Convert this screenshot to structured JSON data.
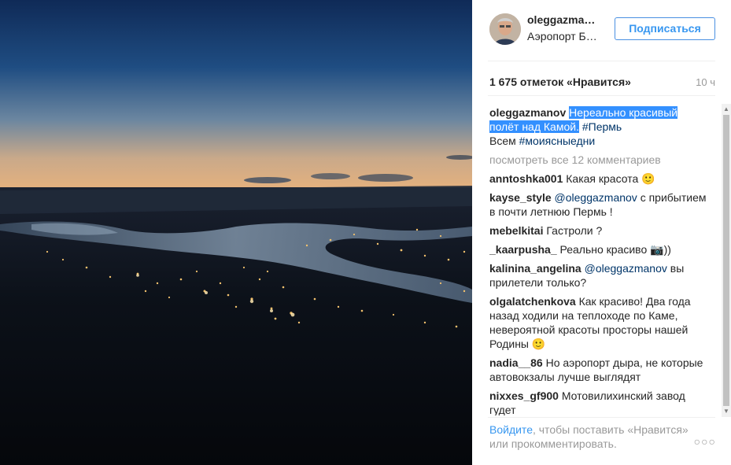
{
  "post": {
    "username": "oleggazmanov",
    "username_display": "oleggazma…",
    "location_display": "Аэропорт Б…",
    "follow_label": "Подписаться",
    "likes": "1 675 отметок «Нравится»",
    "time": "10 ч"
  },
  "caption": {
    "user": "oleggazmanov",
    "text_highlighted": "Нереально красивый полёт над Камой.",
    "hashtag1": "#Пермь",
    "text2": "Всем",
    "hashtag2": "#моиясныедни"
  },
  "view_all": "посмотреть все 12 комментариев",
  "comments": [
    {
      "user": "anntoshka001",
      "text": "Какая красота 🙂"
    },
    {
      "user": "kayse_style",
      "mention": "@oleggazmanov",
      "text": "с прибытием в почти летнюю Пермь !"
    },
    {
      "user": "mebelkitai",
      "text": "Гастроли ?"
    },
    {
      "user": "_kaarpusha_",
      "text": "Реально красиво 📷))"
    },
    {
      "user": "kalinina_angelina",
      "mention": "@oleggazmanov",
      "text": "вы прилетели только?"
    },
    {
      "user": "olgalatchenkova",
      "text": "Как красиво! Два года назад ходили на теплоходе по Каме, невероятной красоты просторы нашей Родины 🙂"
    },
    {
      "user": "nadia__86",
      "text": "Но аэропорт дыра, не которые автовокзалы лучше выглядят"
    },
    {
      "user": "nixxes_gf900",
      "text": "Мотовилихинский завод гудет"
    }
  ],
  "footer": {
    "login": "Войдите",
    "text": ", чтобы поставить «Нравится» или прокомментировать.",
    "more_icon": "ellipsis-icon"
  },
  "colors": {
    "accent": "#3897f0",
    "highlight": "#3390ff",
    "muted": "#999999"
  }
}
